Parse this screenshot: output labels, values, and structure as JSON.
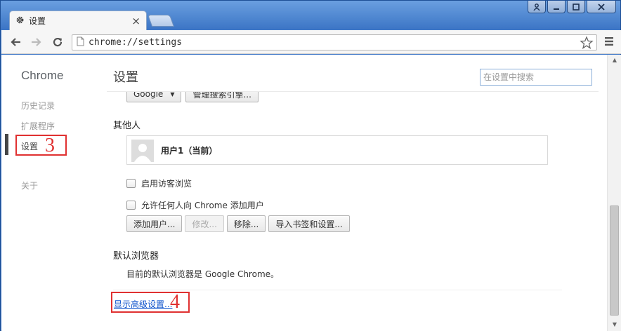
{
  "window": {
    "tab_title": "设置",
    "url": "chrome://settings"
  },
  "sidebar": {
    "brand": "Chrome",
    "items": [
      {
        "label": "历史记录"
      },
      {
        "label": "扩展程序"
      },
      {
        "label": "设置",
        "active": true
      },
      {
        "label": "关于"
      }
    ]
  },
  "header": {
    "title": "设置",
    "search_placeholder": "在设置中搜索"
  },
  "search_engine": {
    "selected": "Google",
    "manage_label": "管理搜索引擎..."
  },
  "people": {
    "section_title": "其他人",
    "user_label": "用户1（当前）",
    "guest_browsing_label": "启用访客浏览",
    "allow_add_label": "允许任何人向 Chrome 添加用户",
    "buttons": {
      "add": "添加用户...",
      "edit": "修改...",
      "remove": "移除...",
      "import": "导入书签和设置..."
    }
  },
  "default_browser": {
    "section_title": "默认浏览器",
    "status_text": "目前的默认浏览器是 Google Chrome。"
  },
  "advanced_link": "显示高级设置...",
  "annotations": {
    "step3": "3",
    "step4": "4"
  },
  "colors": {
    "annotation_red": "#e03131",
    "link_blue": "#1155cc",
    "frame_blue": "#3d76c6"
  }
}
